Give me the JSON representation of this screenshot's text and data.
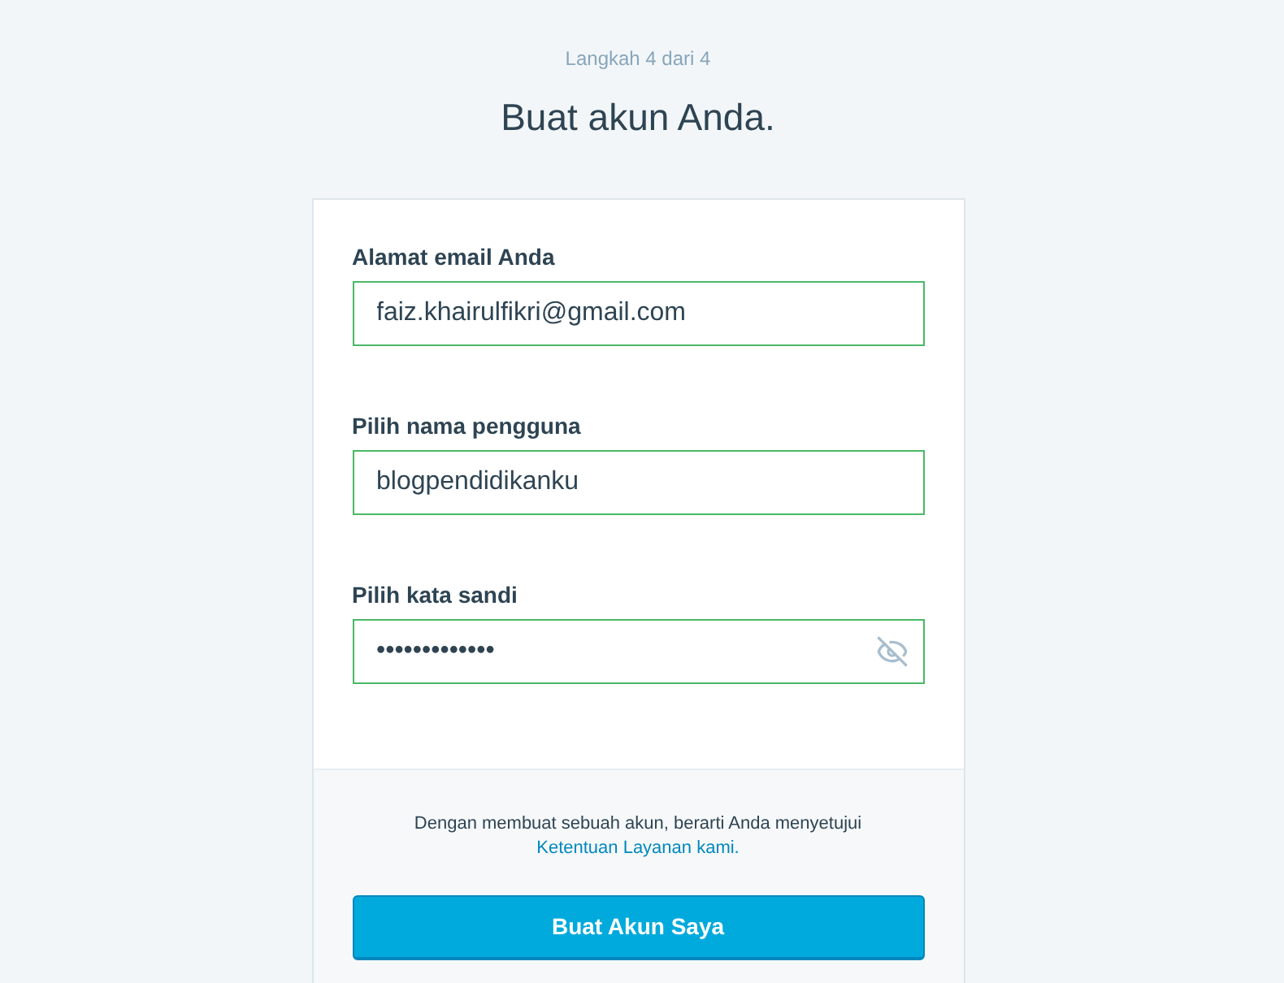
{
  "step": "Langkah 4 dari 4",
  "title": "Buat akun Anda.",
  "fields": [
    {
      "kind": "text",
      "label": "Alamat email Anda",
      "value": "faiz.khairulfikri@gmail.com",
      "valid": true
    },
    {
      "kind": "text",
      "label": "Pilih nama pengguna",
      "value": "blogpendidikanku",
      "valid": true
    },
    {
      "kind": "password",
      "label": "Pilih kata sandi",
      "value": "•••••••••••••",
      "valid": true
    }
  ],
  "terms": {
    "text": "Dengan membuat sebuah akun, berarti Anda menyetujui",
    "link": "Ketentuan Layanan kami."
  },
  "submit": "Buat Akun Saya"
}
